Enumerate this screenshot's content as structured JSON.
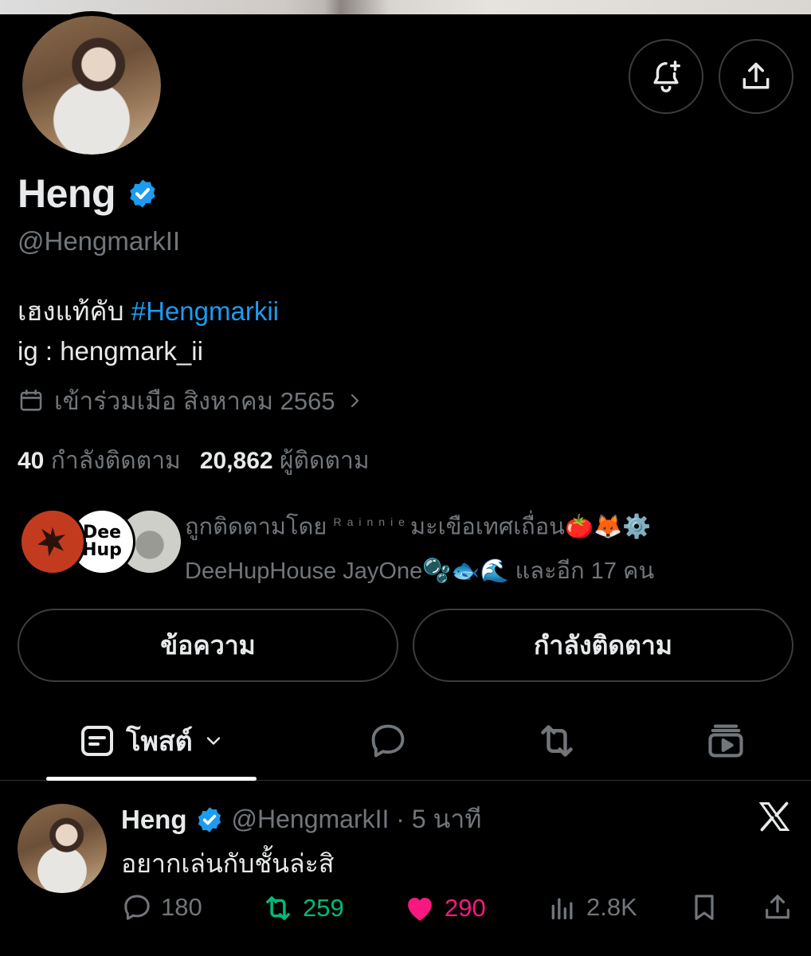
{
  "profile": {
    "display_name": "Heng",
    "handle": "@HengmarkII",
    "bio_line1": "เฮงแท้คับ ",
    "bio_hashtag": "#Hengmarkii",
    "bio_line2": " ig : hengmark_ii",
    "joined": "เข้าร่วมเมือ สิงหาคม 2565",
    "following_count": "40",
    "following_label": "กำลังติดตาม",
    "followers_count": "20,862",
    "followers_label": "ผู้ติดตาม"
  },
  "followed_by": {
    "prefix": "ถูกติดตามโดย ",
    "name1_small": "Rainnie",
    "name1_rest": "มะเขือเทศเถื่อน",
    "name1_emoji": "🍅🦊⚙️",
    "name2": "DeeHupHouse",
    "name3": " JayOne",
    "name3_emoji": "🫧🐟🌊",
    "suffix": " และอีก 17 คน",
    "avatar2_text": "Dee Hup"
  },
  "buttons": {
    "message": "ข้อความ",
    "following": "กำลังติดตาม"
  },
  "tabs": {
    "posts_label": "โพสต์"
  },
  "post": {
    "name": "Heng",
    "handle_time": "@HengmarkII · 5 นาที",
    "text": "อยากเล่นกับชั้นล่ะสิ",
    "replies": "180",
    "reposts": "259",
    "likes": "290",
    "views": "2.8K"
  },
  "colors": {
    "background": "#000000",
    "text": "#e7e9ea",
    "muted": "#71767b",
    "accent": "#1d9bf0",
    "repost": "#00ba7c",
    "like": "#f91880"
  },
  "icons": [
    "bell-plus-icon",
    "share-icon",
    "verified-badge-icon",
    "calendar-icon",
    "chevron-right-icon",
    "posts-icon",
    "chevron-down-icon",
    "reply-icon",
    "repost-icon",
    "media-icon",
    "x-logo-icon",
    "heart-icon",
    "views-icon",
    "bookmark-icon"
  ]
}
